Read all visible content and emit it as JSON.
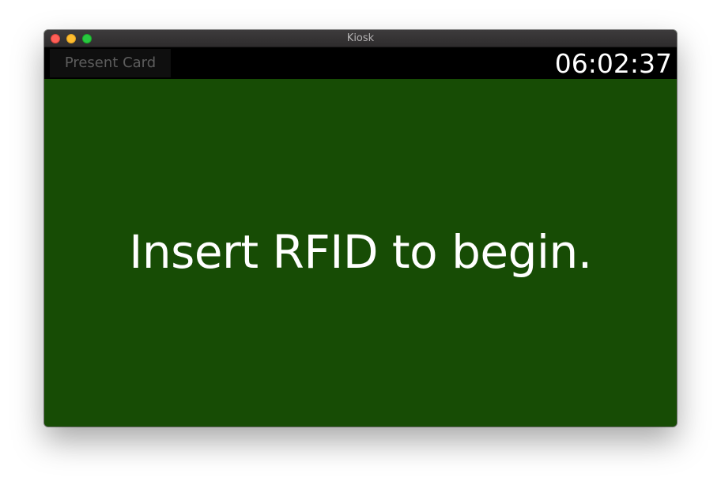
{
  "window": {
    "title": "Kiosk"
  },
  "toolbar": {
    "present_card_label": "Present Card",
    "clock": "06:02:37"
  },
  "main": {
    "prompt": "Insert RFID to begin."
  },
  "colors": {
    "background": "#174c05",
    "toolbar": "#000000",
    "button_bg": "#0f0f0f",
    "button_text": "#5d5d5d",
    "text": "#ffffff"
  }
}
